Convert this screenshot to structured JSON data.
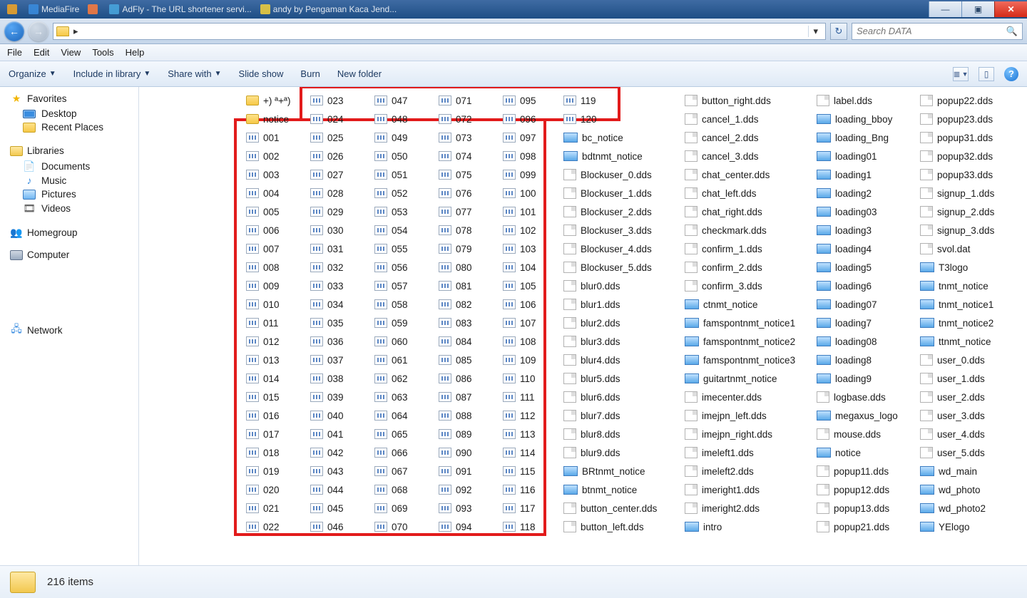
{
  "tabs": [
    {
      "label": "",
      "fav": "#f5a623"
    },
    {
      "label": "MediaFire",
      "fav": "#3a8de0"
    },
    {
      "label": "",
      "fav": "#ff7b3b"
    },
    {
      "label": "AdFly - The URL shortener servi...",
      "fav": "#49a8e0"
    },
    {
      "label": "andy by Pengaman Kaca Jend...",
      "fav": "#f5d23a"
    }
  ],
  "window_buttons": {
    "minimize": "—",
    "maximize": "▣",
    "close": "✕"
  },
  "nav": {
    "back": "←",
    "forward": "→"
  },
  "address": {
    "crumb": "",
    "history_drop": "▾"
  },
  "refresh": "↻",
  "search_placeholder": "Search DATA",
  "menubar": [
    "File",
    "Edit",
    "View",
    "Tools",
    "Help"
  ],
  "cmdbar": {
    "organize": "Organize",
    "include": "Include in library",
    "share": "Share with",
    "slideshow": "Slide show",
    "burn": "Burn",
    "newfolder": "New folder"
  },
  "sidebar": {
    "favorites": {
      "label": "Favorites",
      "items": [
        "Desktop",
        "Recent Places"
      ]
    },
    "libraries": {
      "label": "Libraries",
      "items": [
        "Documents",
        "Music",
        "Pictures",
        "Videos"
      ]
    },
    "homegroup": {
      "label": "Homegroup"
    },
    "computer": {
      "label": "Computer"
    },
    "network": {
      "label": "Network"
    }
  },
  "status": {
    "count_label": "216 items"
  },
  "columns": {
    "col0": [
      {
        "icon": "folder",
        "label": "+) ª+ª)"
      },
      {
        "icon": "folder",
        "label": "notice"
      },
      {
        "icon": "imi",
        "label": "001"
      },
      {
        "icon": "imi",
        "label": "002"
      },
      {
        "icon": "imi",
        "label": "003"
      },
      {
        "icon": "imi",
        "label": "004"
      },
      {
        "icon": "imi",
        "label": "005"
      },
      {
        "icon": "imi",
        "label": "006"
      },
      {
        "icon": "imi",
        "label": "007"
      },
      {
        "icon": "imi",
        "label": "008"
      },
      {
        "icon": "imi",
        "label": "009"
      },
      {
        "icon": "imi",
        "label": "010"
      },
      {
        "icon": "imi",
        "label": "011"
      },
      {
        "icon": "imi",
        "label": "012"
      },
      {
        "icon": "imi",
        "label": "013"
      },
      {
        "icon": "imi",
        "label": "014"
      },
      {
        "icon": "imi",
        "label": "015"
      },
      {
        "icon": "imi",
        "label": "016"
      },
      {
        "icon": "imi",
        "label": "017"
      },
      {
        "icon": "imi",
        "label": "018"
      },
      {
        "icon": "imi",
        "label": "019"
      },
      {
        "icon": "imi",
        "label": "020"
      },
      {
        "icon": "imi",
        "label": "021"
      },
      {
        "icon": "imi",
        "label": "022"
      }
    ],
    "col1": [
      {
        "icon": "imi",
        "label": "023"
      },
      {
        "icon": "imi",
        "label": "024"
      },
      {
        "icon": "imi",
        "label": "025"
      },
      {
        "icon": "imi",
        "label": "026"
      },
      {
        "icon": "imi",
        "label": "027"
      },
      {
        "icon": "imi",
        "label": "028"
      },
      {
        "icon": "imi",
        "label": "029"
      },
      {
        "icon": "imi",
        "label": "030"
      },
      {
        "icon": "imi",
        "label": "031"
      },
      {
        "icon": "imi",
        "label": "032"
      },
      {
        "icon": "imi",
        "label": "033"
      },
      {
        "icon": "imi",
        "label": "034"
      },
      {
        "icon": "imi",
        "label": "035"
      },
      {
        "icon": "imi",
        "label": "036"
      },
      {
        "icon": "imi",
        "label": "037"
      },
      {
        "icon": "imi",
        "label": "038"
      },
      {
        "icon": "imi",
        "label": "039"
      },
      {
        "icon": "imi",
        "label": "040"
      },
      {
        "icon": "imi",
        "label": "041"
      },
      {
        "icon": "imi",
        "label": "042"
      },
      {
        "icon": "imi",
        "label": "043"
      },
      {
        "icon": "imi",
        "label": "044"
      },
      {
        "icon": "imi",
        "label": "045"
      },
      {
        "icon": "imi",
        "label": "046"
      }
    ],
    "col2": [
      {
        "icon": "imi",
        "label": "047"
      },
      {
        "icon": "imi",
        "label": "048"
      },
      {
        "icon": "imi",
        "label": "049"
      },
      {
        "icon": "imi",
        "label": "050"
      },
      {
        "icon": "imi",
        "label": "051"
      },
      {
        "icon": "imi",
        "label": "052"
      },
      {
        "icon": "imi",
        "label": "053"
      },
      {
        "icon": "imi",
        "label": "054"
      },
      {
        "icon": "imi",
        "label": "055"
      },
      {
        "icon": "imi",
        "label": "056"
      },
      {
        "icon": "imi",
        "label": "057"
      },
      {
        "icon": "imi",
        "label": "058"
      },
      {
        "icon": "imi",
        "label": "059"
      },
      {
        "icon": "imi",
        "label": "060"
      },
      {
        "icon": "imi",
        "label": "061"
      },
      {
        "icon": "imi",
        "label": "062"
      },
      {
        "icon": "imi",
        "label": "063"
      },
      {
        "icon": "imi",
        "label": "064"
      },
      {
        "icon": "imi",
        "label": "065"
      },
      {
        "icon": "imi",
        "label": "066"
      },
      {
        "icon": "imi",
        "label": "067"
      },
      {
        "icon": "imi",
        "label": "068"
      },
      {
        "icon": "imi",
        "label": "069"
      },
      {
        "icon": "imi",
        "label": "070"
      }
    ],
    "col3": [
      {
        "icon": "imi",
        "label": "071"
      },
      {
        "icon": "imi",
        "label": "072"
      },
      {
        "icon": "imi",
        "label": "073"
      },
      {
        "icon": "imi",
        "label": "074"
      },
      {
        "icon": "imi",
        "label": "075"
      },
      {
        "icon": "imi",
        "label": "076"
      },
      {
        "icon": "imi",
        "label": "077"
      },
      {
        "icon": "imi",
        "label": "078"
      },
      {
        "icon": "imi",
        "label": "079"
      },
      {
        "icon": "imi",
        "label": "080"
      },
      {
        "icon": "imi",
        "label": "081"
      },
      {
        "icon": "imi",
        "label": "082"
      },
      {
        "icon": "imi",
        "label": "083"
      },
      {
        "icon": "imi",
        "label": "084"
      },
      {
        "icon": "imi",
        "label": "085"
      },
      {
        "icon": "imi",
        "label": "086"
      },
      {
        "icon": "imi",
        "label": "087"
      },
      {
        "icon": "imi",
        "label": "088"
      },
      {
        "icon": "imi",
        "label": "089"
      },
      {
        "icon": "imi",
        "label": "090"
      },
      {
        "icon": "imi",
        "label": "091"
      },
      {
        "icon": "imi",
        "label": "092"
      },
      {
        "icon": "imi",
        "label": "093"
      },
      {
        "icon": "imi",
        "label": "094"
      }
    ],
    "col4": [
      {
        "icon": "imi",
        "label": "095"
      },
      {
        "icon": "imi",
        "label": "096"
      },
      {
        "icon": "imi",
        "label": "097"
      },
      {
        "icon": "imi",
        "label": "098"
      },
      {
        "icon": "imi",
        "label": "099"
      },
      {
        "icon": "imi",
        "label": "100"
      },
      {
        "icon": "imi",
        "label": "101"
      },
      {
        "icon": "imi",
        "label": "102"
      },
      {
        "icon": "imi",
        "label": "103"
      },
      {
        "icon": "imi",
        "label": "104"
      },
      {
        "icon": "imi",
        "label": "105"
      },
      {
        "icon": "imi",
        "label": "106"
      },
      {
        "icon": "imi",
        "label": "107"
      },
      {
        "icon": "imi",
        "label": "108"
      },
      {
        "icon": "imi",
        "label": "109"
      },
      {
        "icon": "imi",
        "label": "110"
      },
      {
        "icon": "imi",
        "label": "111"
      },
      {
        "icon": "imi",
        "label": "112"
      },
      {
        "icon": "imi",
        "label": "113"
      },
      {
        "icon": "imi",
        "label": "114"
      },
      {
        "icon": "imi",
        "label": "115"
      },
      {
        "icon": "imi",
        "label": "116"
      },
      {
        "icon": "imi",
        "label": "117"
      },
      {
        "icon": "imi",
        "label": "118"
      }
    ],
    "col5": [
      {
        "icon": "imi",
        "label": "119"
      },
      {
        "icon": "imi",
        "label": "120"
      },
      {
        "icon": "thumb",
        "label": "bc_notice"
      },
      {
        "icon": "thumb",
        "label": "bdtnmt_notice"
      },
      {
        "icon": "dds",
        "label": "Blockuser_0.dds"
      },
      {
        "icon": "dds",
        "label": "Blockuser_1.dds"
      },
      {
        "icon": "dds",
        "label": "Blockuser_2.dds"
      },
      {
        "icon": "dds",
        "label": "Blockuser_3.dds"
      },
      {
        "icon": "dds",
        "label": "Blockuser_4.dds"
      },
      {
        "icon": "dds",
        "label": "Blockuser_5.dds"
      },
      {
        "icon": "dds",
        "label": "blur0.dds"
      },
      {
        "icon": "dds",
        "label": "blur1.dds"
      },
      {
        "icon": "dds",
        "label": "blur2.dds"
      },
      {
        "icon": "dds",
        "label": "blur3.dds"
      },
      {
        "icon": "dds",
        "label": "blur4.dds"
      },
      {
        "icon": "dds",
        "label": "blur5.dds"
      },
      {
        "icon": "dds",
        "label": "blur6.dds"
      },
      {
        "icon": "dds",
        "label": "blur7.dds"
      },
      {
        "icon": "dds",
        "label": "blur8.dds"
      },
      {
        "icon": "dds",
        "label": "blur9.dds"
      },
      {
        "icon": "thumb",
        "label": "BRtnmt_notice"
      },
      {
        "icon": "thumb",
        "label": "btnmt_notice"
      },
      {
        "icon": "dds",
        "label": "button_center.dds"
      },
      {
        "icon": "dds",
        "label": "button_left.dds"
      }
    ],
    "col6": [
      {
        "icon": "dds",
        "label": "button_right.dds"
      },
      {
        "icon": "dds",
        "label": "cancel_1.dds"
      },
      {
        "icon": "dds",
        "label": "cancel_2.dds"
      },
      {
        "icon": "dds",
        "label": "cancel_3.dds"
      },
      {
        "icon": "dds",
        "label": "chat_center.dds"
      },
      {
        "icon": "dds",
        "label": "chat_left.dds"
      },
      {
        "icon": "dds",
        "label": "chat_right.dds"
      },
      {
        "icon": "dds",
        "label": "checkmark.dds"
      },
      {
        "icon": "dds",
        "label": "confirm_1.dds"
      },
      {
        "icon": "dds",
        "label": "confirm_2.dds"
      },
      {
        "icon": "dds",
        "label": "confirm_3.dds"
      },
      {
        "icon": "thumb",
        "label": "ctnmt_notice"
      },
      {
        "icon": "thumb",
        "label": "famspontnmt_notice1"
      },
      {
        "icon": "thumb",
        "label": "famspontnmt_notice2"
      },
      {
        "icon": "thumb",
        "label": "famspontnmt_notice3"
      },
      {
        "icon": "thumb",
        "label": "guitartnmt_notice"
      },
      {
        "icon": "dds",
        "label": "imecenter.dds"
      },
      {
        "icon": "dds",
        "label": "imejpn_left.dds"
      },
      {
        "icon": "dds",
        "label": "imejpn_right.dds"
      },
      {
        "icon": "dds",
        "label": "imeleft1.dds"
      },
      {
        "icon": "dds",
        "label": "imeleft2.dds"
      },
      {
        "icon": "dds",
        "label": "imeright1.dds"
      },
      {
        "icon": "dds",
        "label": "imeright2.dds"
      },
      {
        "icon": "thumb",
        "label": "intro"
      }
    ],
    "col7": [
      {
        "icon": "dds",
        "label": "label.dds"
      },
      {
        "icon": "thumb",
        "label": "loading_bboy"
      },
      {
        "icon": "thumb",
        "label": "loading_Bng"
      },
      {
        "icon": "thumb",
        "label": "loading01"
      },
      {
        "icon": "thumb",
        "label": "loading1"
      },
      {
        "icon": "thumb",
        "label": "loading2"
      },
      {
        "icon": "thumb",
        "label": "loading03"
      },
      {
        "icon": "thumb",
        "label": "loading3"
      },
      {
        "icon": "thumb",
        "label": "loading4"
      },
      {
        "icon": "thumb",
        "label": "loading5"
      },
      {
        "icon": "thumb",
        "label": "loading6"
      },
      {
        "icon": "thumb",
        "label": "loading07"
      },
      {
        "icon": "thumb",
        "label": "loading7"
      },
      {
        "icon": "thumb",
        "label": "loading08"
      },
      {
        "icon": "thumb",
        "label": "loading8"
      },
      {
        "icon": "thumb",
        "label": "loading9"
      },
      {
        "icon": "dds",
        "label": "logbase.dds"
      },
      {
        "icon": "thumb",
        "label": "megaxus_logo"
      },
      {
        "icon": "dds",
        "label": "mouse.dds"
      },
      {
        "icon": "thumb",
        "label": "notice"
      },
      {
        "icon": "dds",
        "label": "popup11.dds"
      },
      {
        "icon": "dds",
        "label": "popup12.dds"
      },
      {
        "icon": "dds",
        "label": "popup13.dds"
      },
      {
        "icon": "dds",
        "label": "popup21.dds"
      }
    ],
    "col8": [
      {
        "icon": "dds",
        "label": "popup22.dds"
      },
      {
        "icon": "dds",
        "label": "popup23.dds"
      },
      {
        "icon": "dds",
        "label": "popup31.dds"
      },
      {
        "icon": "dds",
        "label": "popup32.dds"
      },
      {
        "icon": "dds",
        "label": "popup33.dds"
      },
      {
        "icon": "dds",
        "label": "signup_1.dds"
      },
      {
        "icon": "dds",
        "label": "signup_2.dds"
      },
      {
        "icon": "dds",
        "label": "signup_3.dds"
      },
      {
        "icon": "dds",
        "label": "svol.dat"
      },
      {
        "icon": "thumb",
        "label": "T3logo"
      },
      {
        "icon": "thumb",
        "label": "tnmt_notice"
      },
      {
        "icon": "thumb",
        "label": "tnmt_notice1"
      },
      {
        "icon": "thumb",
        "label": "tnmt_notice2"
      },
      {
        "icon": "thumb",
        "label": "ttnmt_notice"
      },
      {
        "icon": "dds",
        "label": "user_0.dds"
      },
      {
        "icon": "dds",
        "label": "user_1.dds"
      },
      {
        "icon": "dds",
        "label": "user_2.dds"
      },
      {
        "icon": "dds",
        "label": "user_3.dds"
      },
      {
        "icon": "dds",
        "label": "user_4.dds"
      },
      {
        "icon": "dds",
        "label": "user_5.dds"
      },
      {
        "icon": "thumb",
        "label": "wd_main"
      },
      {
        "icon": "thumb",
        "label": "wd_photo"
      },
      {
        "icon": "thumb",
        "label": "wd_photo2"
      },
      {
        "icon": "thumb",
        "label": "YElogo"
      }
    ]
  },
  "column_left": {
    "col0": 345,
    "col1": 435,
    "col2": 525,
    "col3": 615,
    "col4": 705,
    "col5": 790,
    "col6": 960,
    "col7": 1145,
    "col8": 1290
  }
}
